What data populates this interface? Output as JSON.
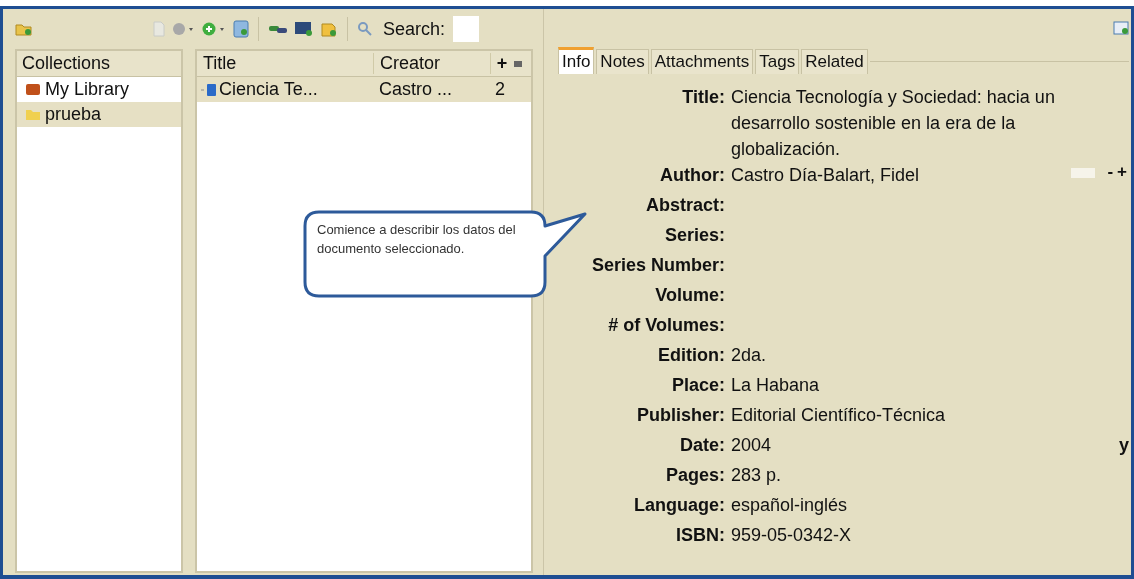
{
  "toolbar": {
    "search_label": "Search:"
  },
  "collections": {
    "header": "Collections",
    "items": [
      {
        "label": "My Library",
        "kind": "library",
        "selected": false
      },
      {
        "label": "prueba",
        "kind": "folder",
        "selected": true
      }
    ]
  },
  "items": {
    "columns": [
      "Title",
      "Creator",
      "+"
    ],
    "rows": [
      {
        "title": "Ciencia Te...",
        "creator": "Castro ...",
        "count": "2",
        "selected": true
      }
    ]
  },
  "tabs": [
    {
      "label": "Info",
      "selected": true
    },
    {
      "label": "Notes",
      "selected": false
    },
    {
      "label": "Attachments",
      "selected": false
    },
    {
      "label": "Tags",
      "selected": false
    },
    {
      "label": "Related",
      "selected": false
    }
  ],
  "fields": [
    {
      "label": "Title:",
      "value": "Ciencia Tecnología y Sociedad: hacia un desarrollo sostenible en la era de la globalización.",
      "kind": "text"
    },
    {
      "label": "Author:",
      "value": "Castro Día-Balart,  Fidel",
      "kind": "creator",
      "buttons": [
        "-",
        "+"
      ]
    },
    {
      "label": "Abstract:",
      "kind": "text"
    },
    {
      "label": "Series:",
      "kind": "text"
    },
    {
      "label": "Series Number:",
      "kind": "text"
    },
    {
      "label": "Volume:",
      "kind": "text"
    },
    {
      "label": "# of Volumes:",
      "kind": "text"
    },
    {
      "label": "Edition:",
      "value": "2da.",
      "kind": "text"
    },
    {
      "label": "Place:",
      "value": "La Habana",
      "kind": "text"
    },
    {
      "label": "Publisher:",
      "value": "Editorial Científico-Técnica",
      "kind": "text"
    },
    {
      "label": "Date:",
      "value": "2004",
      "kind": "date",
      "suffix": "y"
    },
    {
      "label": "Pages:",
      "value": "283 p.",
      "kind": "text"
    },
    {
      "label": "Language:",
      "value": "español-inglés",
      "kind": "text"
    },
    {
      "label": "ISBN:",
      "value": "959-05-0342-X",
      "kind": "text"
    }
  ],
  "callout": {
    "text": "Comience a describir los datos del documento seleccionado."
  }
}
